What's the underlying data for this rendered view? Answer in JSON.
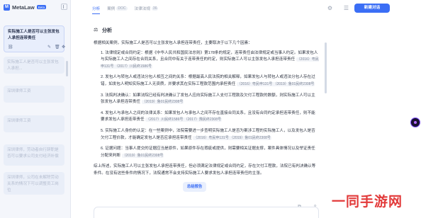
{
  "app": {
    "name": "MetaLaw",
    "badge": "Beta"
  },
  "sidebar": {
    "active_session": "实际施工人是否可以主张发包人承担连带责任",
    "faded_sessions": [
      "实际施工人是否可以主张发包人承担...",
      "深圳律师工资",
      "深圳律师工资",
      "深圳律师，劳动者自行辞职是否可以要求公司支付经济补偿",
      "深圳律师，公司在未解除劳动关系的情况下可以调整员工岗位"
    ]
  },
  "header": {
    "tabs": [
      {
        "label": "分析",
        "active": true
      },
      {
        "label": "案例",
        "badge": "DOC"
      },
      {
        "label": "法律法规",
        "badge": "36"
      }
    ],
    "new_chat_label": "新建对话"
  },
  "analysis": {
    "title": "分析",
    "intro": "根据相关案例，实际施工人是否可以主张发包人承担连带责任，主要取决于以下几个因素：",
    "points": [
      {
        "text": "1. 法律规定或合同约定：根据《中华人民共和国民法总则》第178条的规定，连带责任由法律规定或当事人约定。如果发包人与实际施工人之间存在合同关系，且合同中有关于连带责任的约定，则实际施工人可以主张发包人承担连带责任",
        "cite": "（2016）粤民申131号 （2017）川民终1586号"
      },
      {
        "text": "2. 发包人与转包人或违法分包人相互之间的关系：根据最高人民法院的相关解释，如果发包人与转包人或违法分包人存在过错，如发包人明知实际施工人无资质，并要求其在实际工程款范围内承担责任",
        "cite": "（2016）粤民申131号 （2019）鲁01民终2308号"
      },
      {
        "text": "3. 法院判决确认：如果法院已经有判决确认了发包人应向实际施工人支付工程款及欠付工程款的数额，则实际施工人可以主张发包人承担连带责任",
        "cite": "（2019）鲁01民终2308号"
      },
      {
        "text": "4. 发包人与承包人之间的法律关系：如果发包人与承包人之间不存在直接合同关系，且没有合同约定承担连带责任，则不能要求发包人承担连带责任",
        "cite": "（2017）川民终1586号 （2017）豫民终2308号"
      },
      {
        "text": "5. 实际施工人身份的认定：在一些案例中，法院需要进一步查明实际施工人是否为案涉工程的实际施工人，以及发包人是否欠付工程价款，才能确定发包人是否应承担连带责任",
        "cite": "（2016）粤民申131号 （2019）鲁01民终2308号"
      },
      {
        "text": "6. 证据问题：当事人提交的证据应当是原件，如果原件存在瑕疵或提供，则需要相关证据支撑，案件具体情况以及举证责任分配来判断",
        "cite": "（2019）鲁01民终2308号"
      }
    ],
    "conclusion": "综上所述，实际施工人可以主张发包人承担连带责任，但必须满足法律规定或合同约定，存在欠付工程款，法院已有判决确认等条件。在没有这些条件的情况下，法院通常不会支持实际施工人要求发包人承担连带责任的主张。",
    "download_label": "总结报告"
  },
  "watermark": "一同手游网",
  "colors": {
    "accent": "#3b6ef5",
    "sidebar_bg": "#f4f6fb",
    "watermark": "#e23a3a"
  }
}
